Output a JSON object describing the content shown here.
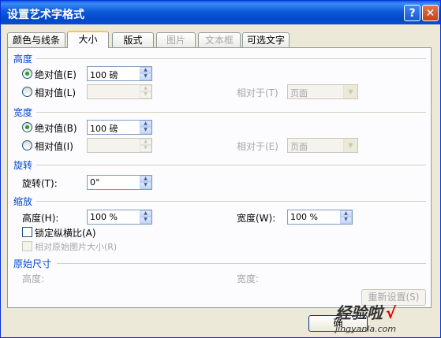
{
  "window": {
    "title": "设置艺术字格式",
    "help_label": "?",
    "close_label": "✕"
  },
  "tabs": [
    {
      "label": "颜色与线条",
      "state": "normal"
    },
    {
      "label": "大小",
      "state": "active"
    },
    {
      "label": "版式",
      "state": "normal"
    },
    {
      "label": "图片",
      "state": "disabled"
    },
    {
      "label": "文本框",
      "state": "disabled"
    },
    {
      "label": "可选文字",
      "state": "normal"
    }
  ],
  "height_section": {
    "title": "高度",
    "absolute_label": "绝对值(E)",
    "absolute_value": "100 磅",
    "relative_label": "相对值(L)",
    "relative_to_label": "相对于(T)",
    "relative_to_value": "页面"
  },
  "width_section": {
    "title": "宽度",
    "absolute_label": "绝对值(B)",
    "absolute_value": "100 磅",
    "relative_label": "相对值(I)",
    "relative_to_label": "相对于(E)",
    "relative_to_value": "页面"
  },
  "rotation_section": {
    "title": "旋转",
    "rotation_label": "旋转(T):",
    "rotation_value": "0°"
  },
  "scale_section": {
    "title": "缩放",
    "height_label": "高度(H):",
    "height_value": "100 %",
    "width_label": "宽度(W):",
    "width_value": "100 %",
    "lock_aspect_label": "锁定纵横比(A)",
    "relative_original_label": "相对原始图片大小(R)"
  },
  "original_size_section": {
    "title": "原始尺寸",
    "height_label": "高度:",
    "width_label": "宽度:"
  },
  "buttons": {
    "reset_label": "重新设置(S)",
    "ok_label": "确"
  },
  "watermark": {
    "line1": "经验啦",
    "check": "√",
    "line2": "jingyanla.com"
  }
}
